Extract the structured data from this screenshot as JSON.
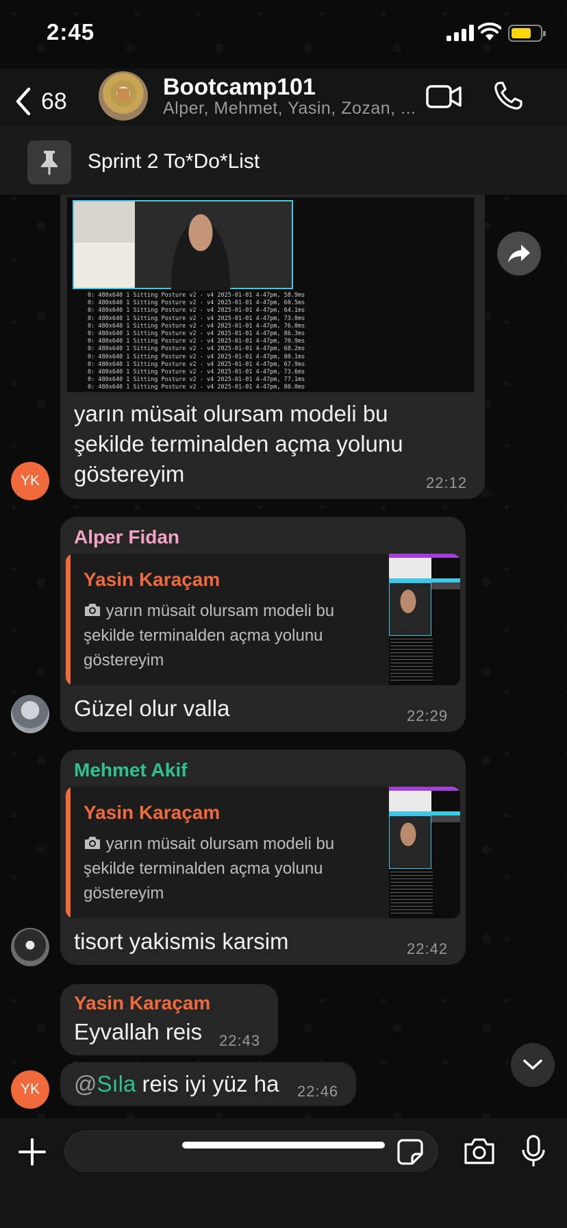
{
  "status_bar": {
    "time": "2:45"
  },
  "header": {
    "back_count": "68",
    "group_name": "Bootcamp101",
    "members": "Alper, Mehmet, Yasin, Zozan, ...",
    "pinned_message": "Sprint 2 To*Do*List"
  },
  "terminal_lines": [
    "0: 480x640 1 Sitting Posture v2 - v4 2025-01-01 4-47pm, 58.9ms",
    "0: 480x640 1 Sitting Posture v2 - v4 2025-01-01 4-47pm, 60.5ms",
    "0: 480x640 1 Sitting Posture v2 - v4 2025-01-01 4-47pm, 64.1ms",
    "0: 480x640 1 Sitting Posture v2 - v4 2025-01-01 4-47pm, 73.0ms",
    "0: 480x640 1 Sitting Posture v2 - v4 2025-01-01 4-47pm, 76.0ms",
    "0: 480x640 1 Sitting Posture v2 - v4 2025-01-01 4-47pm, 86.3ms",
    "0: 480x640 1 Sitting Posture v2 - v4 2025-01-01 4-47pm, 70.9ms",
    "0: 480x640 1 Sitting Posture v2 - v4 2025-01-01 4-47pm, 68.2ms",
    "0: 480x640 1 Sitting Posture v2 - v4 2025-01-01 4-47pm, 80.1ms",
    "0: 480x640 1 Sitting Posture v2 - v4 2025-01-01 4-47pm, 67.9ms",
    "0: 480x640 1 Sitting Posture v2 - v4 2025-01-01 4-47pm, 73.6ms",
    "0: 480x640 1 Sitting Posture v2 - v4 2025-01-01 4-47pm, 77.1ms",
    "0: 480x640 1 Sitting Posture v2 - v4 2025-01-01 4-47pm, 80.0ms",
    "0: 480x640 1 Sitting Posture v2 - v4 2025-01-01 4-47pm, 71.0ms"
  ],
  "messages": [
    {
      "avatar_initials": "YK",
      "text": "yarın müsait olursam modeli bu şekilde terminalden açma yolunu göstereyim",
      "time": "22:12"
    },
    {
      "sender": "Alper Fidan",
      "sender_color": "#f3a3c4",
      "reply_name": "Yasin Karaçam",
      "reply_text": "yarın müsait olursam modeli bu şekilde terminalden açma yolunu göstereyim",
      "text": "Güzel olur valla",
      "time": "22:29"
    },
    {
      "sender": "Mehmet Akif",
      "sender_color": "#2fc28f",
      "reply_name": "Yasin Karaçam",
      "reply_text": "yarın müsait olursam modeli bu şekilde terminalden açma yolunu göstereyim",
      "text": "tisort yakismis karsim",
      "time": "22:42"
    },
    {
      "sender": "Yasin Karaçam",
      "sender_color": "#f06a3c",
      "text": "Eyvallah reis",
      "time": "22:43"
    },
    {
      "avatar_initials": "YK",
      "mention_at": "@",
      "mention_name": "Sıla",
      "text": " reis iyi yüz ha",
      "time": "22:46"
    }
  ],
  "colors": {
    "accent_orange": "#f06a3c",
    "mention_green": "#2fc28f",
    "battery": "#ffd60a"
  }
}
